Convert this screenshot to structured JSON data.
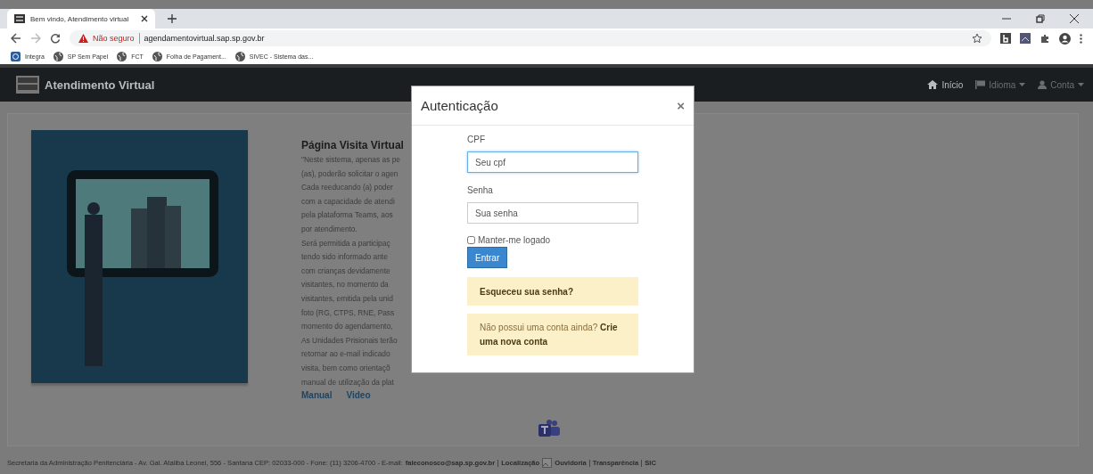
{
  "browser": {
    "tab": {
      "title": "Bem vindo, Atendimento virtual"
    },
    "address": {
      "warning": "Não seguro",
      "url": "agendamentovirtual.sap.sp.gov.br"
    },
    "bookmarks": [
      {
        "label": "Integra",
        "kind": "app"
      },
      {
        "label": "SP Sem Papel",
        "kind": "globe"
      },
      {
        "label": "FCT",
        "kind": "globe"
      },
      {
        "label": "Folha de Pagament...",
        "kind": "globe"
      },
      {
        "label": "SIVEC - Sistema das...",
        "kind": "globe"
      }
    ]
  },
  "navbar": {
    "brand": "Atendimento Virtual",
    "items": [
      {
        "label": "Início",
        "kind": "home",
        "selected": true,
        "dropdown": false
      },
      {
        "label": "Idioma",
        "kind": "flag",
        "selected": false,
        "dropdown": true
      },
      {
        "label": "Conta",
        "kind": "user",
        "selected": false,
        "dropdown": true
      }
    ]
  },
  "content": {
    "heading": "Página Visita Virtual",
    "lines": [
      "\"Neste sistema, apenas as pe",
      "(as), poderão solicitar o agen",
      "Cada reeducando (a) poder",
      "com a capacidade de atendi",
      "pela plataforma Teams, aos",
      "por atendimento.",
      "Será permitida a participaç",
      "tendo sido informado ante",
      "com crianças devidamente",
      "visitantes, no momento da",
      "visitantes, emitida pela unid",
      "foto (RG, CTPS, RNE, Pass",
      "momento do agendamento,",
      "As Unidades Prisionais terão",
      "retornar ao e-mail indicado",
      "visita, bem como orientaçõ",
      "manual de utilização da plat"
    ],
    "links": [
      "Manual",
      "Video"
    ]
  },
  "modal": {
    "title": "Autenticação",
    "close": "×",
    "fields": [
      {
        "label": "CPF",
        "placeholder": "Seu cpf",
        "focused": true
      },
      {
        "label": "Senha",
        "placeholder": "Sua senha",
        "focused": false
      }
    ],
    "remember": {
      "label": "Manter-me logado",
      "checked": false
    },
    "submit": "Entrar",
    "forgot": "Esqueceu sua senha?",
    "signup": "Não possui uma conta ainda? **Crie uma nova conta**"
  },
  "footer": {
    "address": "Secretaria da Administração Penitenciária - Av. Gal. Ataliba Leonel, 556 - Santana CEP: 02033-000 - Fone: (11) 3206-4700 - E-mail:",
    "email": "faleconosco@sap.sp.gov.br",
    "links": [
      "Localização",
      "Ouvidoria",
      "Transparência",
      "SIC"
    ]
  }
}
